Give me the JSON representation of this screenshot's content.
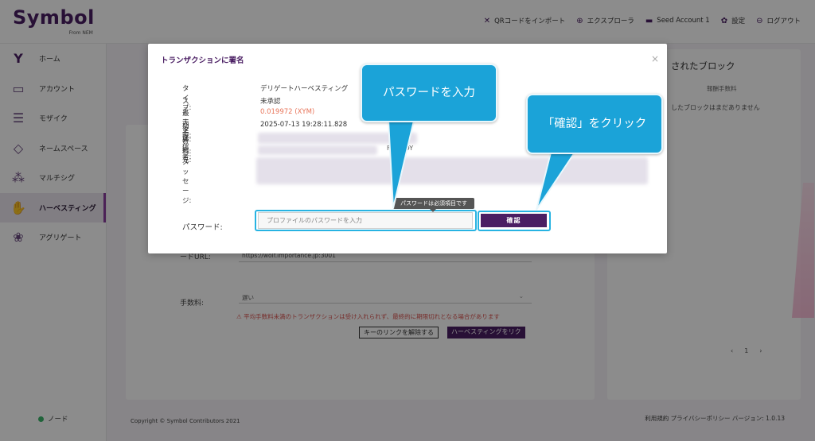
{
  "header": {
    "logo_text": "Symbol",
    "logo_sub": "From NEM",
    "nav": [
      {
        "icon": "qr-icon",
        "label": "QRコードをインポート"
      },
      {
        "icon": "globe-icon",
        "label": "エクスプローラ"
      },
      {
        "icon": "wallet-icon",
        "label": "Seed Account 1"
      },
      {
        "icon": "gear-icon",
        "label": "設定"
      },
      {
        "icon": "logout-icon",
        "label": "ログアウト"
      }
    ]
  },
  "sidebar": {
    "items": [
      {
        "icon": "symbol-y-icon",
        "label": "ホーム"
      },
      {
        "icon": "account-icon",
        "label": "アカウント"
      },
      {
        "icon": "mosaic-icon",
        "label": "モザイク"
      },
      {
        "icon": "tag-icon",
        "label": "ネームスペース"
      },
      {
        "icon": "multisig-icon",
        "label": "マルチシグ"
      },
      {
        "icon": "harvest-hand-icon",
        "label": "ハーベスティング",
        "active": true
      },
      {
        "icon": "aggregate-icon",
        "label": "アグリゲート"
      }
    ],
    "node_label": "ノード",
    "node_color": "#3bb56a"
  },
  "page": {
    "right_panel_title": "されたブロック",
    "right_panel_header": "報酬手数料",
    "right_panel_empty": "したブロックはまだありません",
    "pager": [
      "‹",
      "1",
      "›"
    ],
    "node_url_label": "ードURL:",
    "node_url_value": "https://wolf.importance.jp:3001",
    "fee_label": "手数料:",
    "fee_value": "遅い",
    "warning": "平均手数料未満のトランザクションは受け入れられず、最終的に期限切れとなる場合があります",
    "unlink_button": "キーのリンクを解除する",
    "link_button": "ハーベスティングをリク",
    "footer_copyright": "Copyright © Symbol Contributors 2021",
    "footer_links": "利用規約  プライバシーポリシー  バージョン: 1.0.13"
  },
  "modal": {
    "title": "トランザクションに署名",
    "close": "×",
    "fields": {
      "type_label": "タイプ:",
      "type_value": "デリゲートハーベスティング",
      "status_label": "ステータス:",
      "status_value": "未承認",
      "fee_label": "最大手数料:",
      "fee_value_num": "0.019972",
      "fee_value_unit": " (XYM)",
      "deadline_label": "期限:",
      "deadline_value": "2025-07-13 19:28:11.828",
      "sender_label": "送信者:",
      "recipient_label": "宛先:",
      "recipient_fragment": "FQADDY",
      "message_label": "メッセージ:"
    },
    "password_label": "パスワード:",
    "password_placeholder": "プロファイルのパスワードを入力",
    "tooltip": "パスワードは必須項目です",
    "confirm_button": "確認"
  },
  "callouts": {
    "password": "パスワードを入力",
    "confirm": "「確認」をクリック",
    "color": "#1ba3d8"
  }
}
